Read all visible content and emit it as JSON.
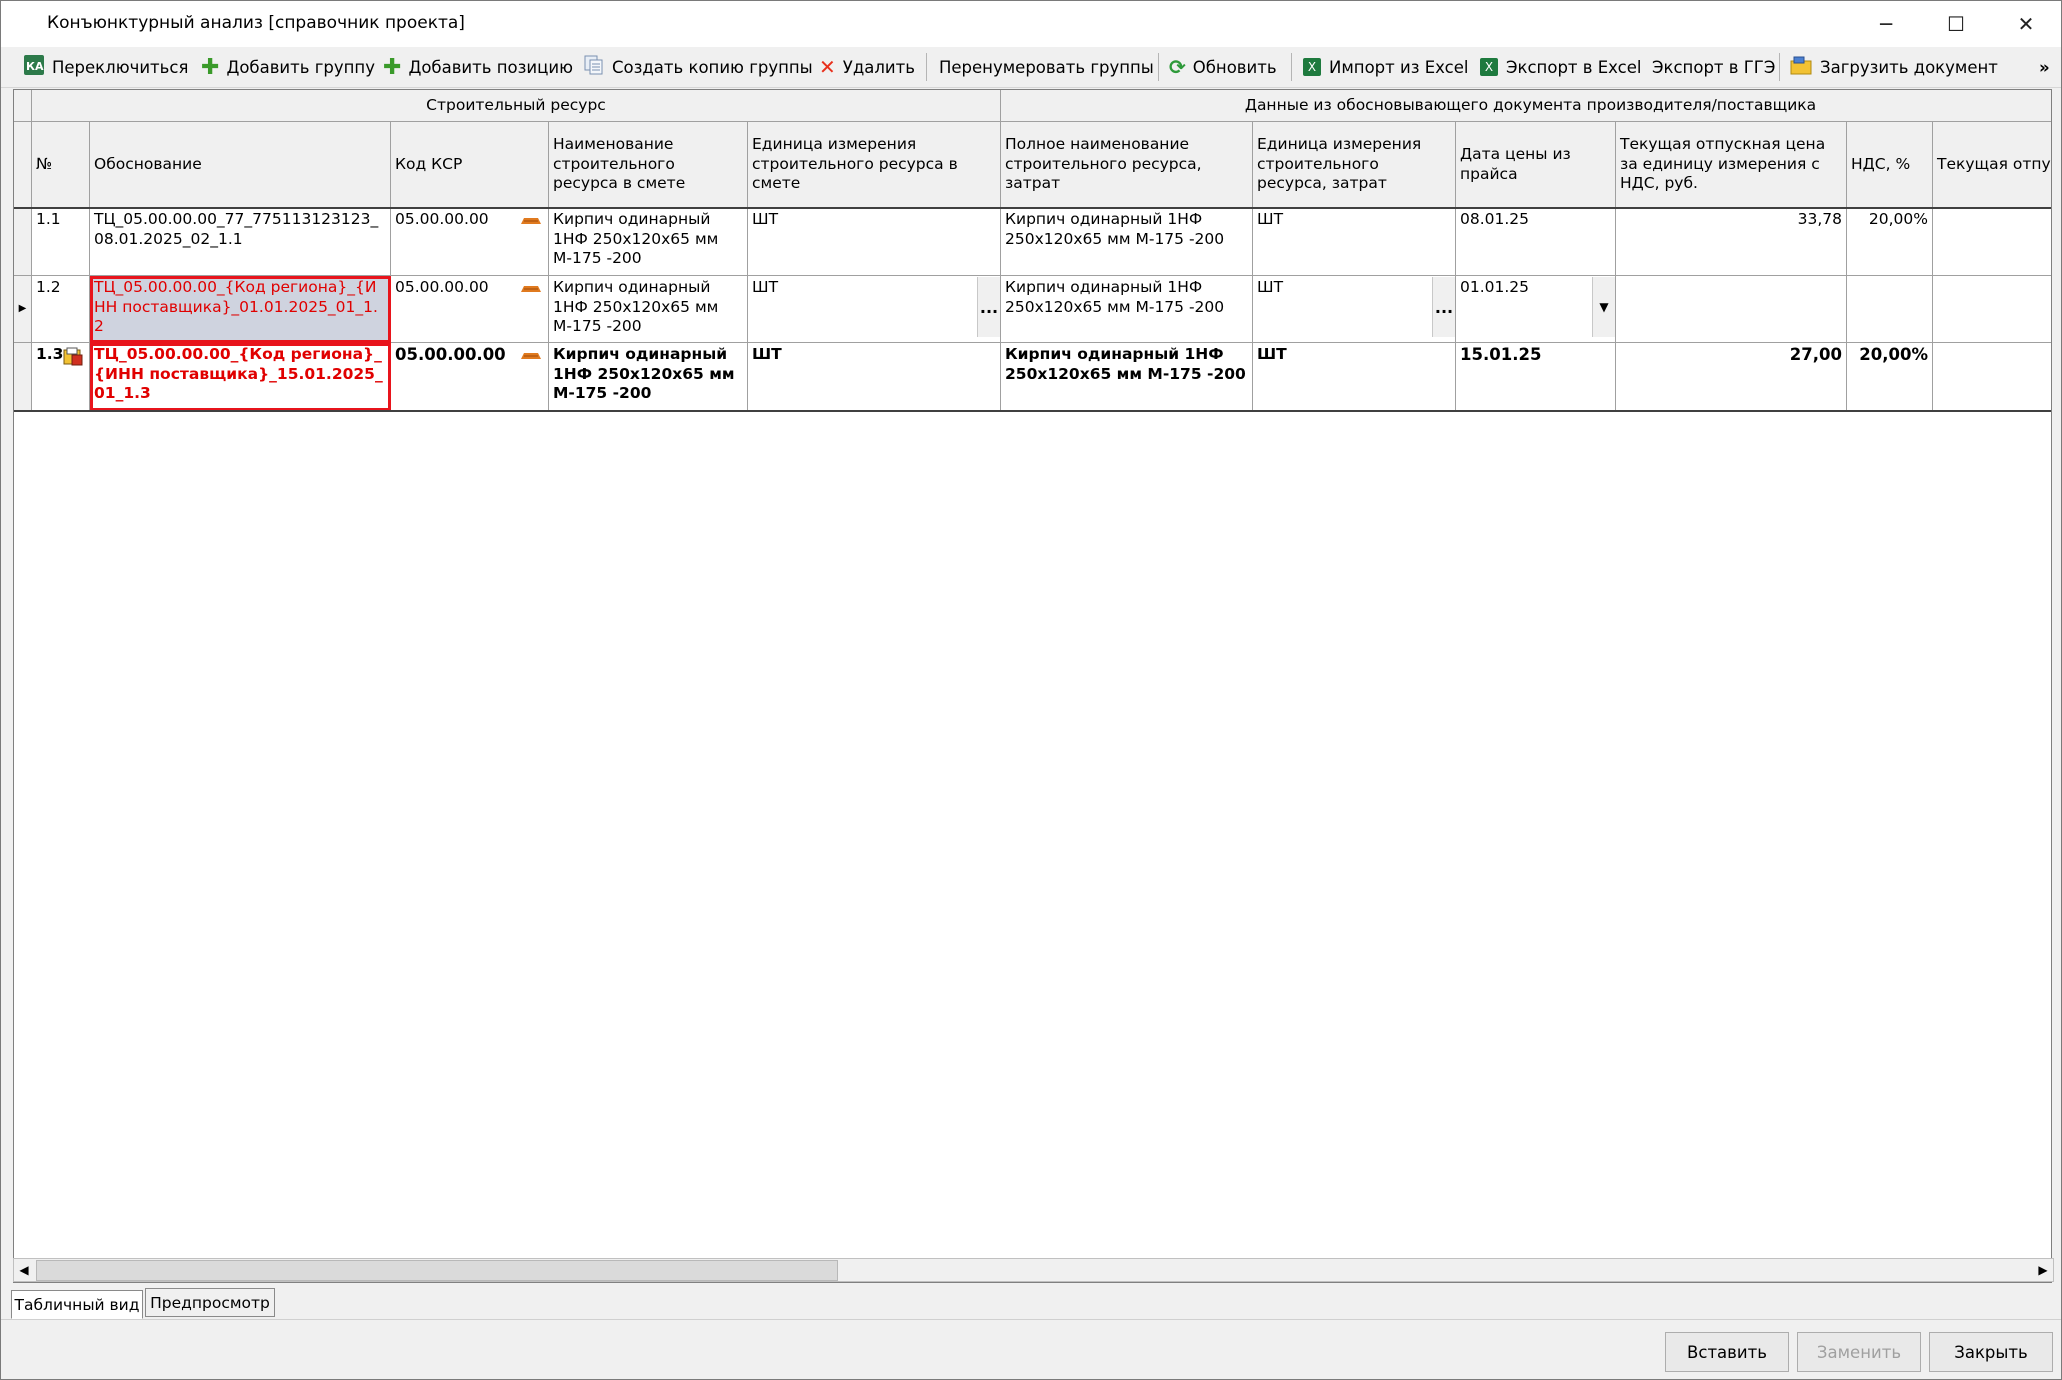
{
  "window": {
    "title": "Конъюнктурный анализ [справочник проекта]",
    "minimize": "─",
    "maximize": "☐",
    "close": "✕"
  },
  "toolbar": {
    "switch": "Переключиться",
    "add_group": "Добавить группу",
    "add_position": "Добавить позицию",
    "copy_group": "Создать копию группы",
    "delete": "Удалить",
    "renumber": "Перенумеровать группы",
    "refresh": "Обновить",
    "import_excel": "Импорт из Excel",
    "export_excel": "Экспорт в Excel",
    "export_gge": "Экспорт в ГГЭ",
    "load_doc": "Загрузить документ",
    "overflow": "»"
  },
  "grid": {
    "group_headers": {
      "resource": "Строительный ресурс",
      "supplier": "Данные из обосновывающего документа производителя/поставщика"
    },
    "columns": {
      "num": "№",
      "basis": "Обоснование",
      "ksr": "Код КСР",
      "name": "Наименование строительного ресурса в смете",
      "unit": "Единица измерения строительного ресурса в смете",
      "full_name": "Полное наименование строительного ресурса, затрат",
      "unit_cost": "Единица измерения строительного ресурса, затрат",
      "date": "Дата цены из прайса",
      "price": "Текущая отпускная цена за единицу измерения с НДС, руб.",
      "vat": "НДС, %",
      "price2": "Текущая отпускная цена за единицу измерения без НДС, руб."
    },
    "rows": [
      {
        "num": "1.1",
        "basis": "ТЦ_05.00.00.00_77_775113123123_08.01.2025_02_1.1",
        "ksr": "05.00.00.00",
        "name": "Кирпич одинарный 1НФ 250х120х65 мм М-175 -200",
        "unit": "ШТ",
        "full_name": "Кирпич одинарный 1НФ 250х120х65 мм М-175 -200",
        "unit_cost": "ШТ",
        "date": "08.01.25",
        "price": "33,78",
        "vat": "20,00%"
      },
      {
        "num": "1.2",
        "basis": "ТЦ_05.00.00.00_{Код региона}_{ИНН поставщика}_01.01.2025_01_1.2",
        "ksr": "05.00.00.00",
        "name": "Кирпич одинарный 1НФ 250х120х65 мм М-175 -200",
        "unit": "ШТ",
        "full_name": "Кирпич одинарный 1НФ 250х120х65 мм М-175 -200",
        "unit_cost": "ШТ",
        "date": "01.01.25",
        "price": "",
        "vat": ""
      },
      {
        "num": "1.3",
        "basis": "ТЦ_05.00.00.00_{Код региона}_{ИНН поставщика}_15.01.2025_01_1.3",
        "ksr": "05.00.00.00",
        "name": "Кирпич одинарный 1НФ 250х120х65 мм М-175 -200",
        "unit": "ШТ",
        "full_name": "Кирпич одинарный 1НФ 250х120х65 мм М-175 -200",
        "unit_cost": "ШТ",
        "date": "15.01.25",
        "price": "27,00",
        "vat": "20,00%"
      }
    ],
    "ellipsis": "...",
    "current_row_marker": "▶"
  },
  "tabs": {
    "table": "Табличный вид",
    "preview": "Предпросмотр"
  },
  "buttons": {
    "insert": "Вставить",
    "replace": "Заменить",
    "close": "Закрыть"
  },
  "colors": {
    "error_red": "#e00000",
    "selection": "#cfd3df",
    "brick": "#e07a1f"
  }
}
